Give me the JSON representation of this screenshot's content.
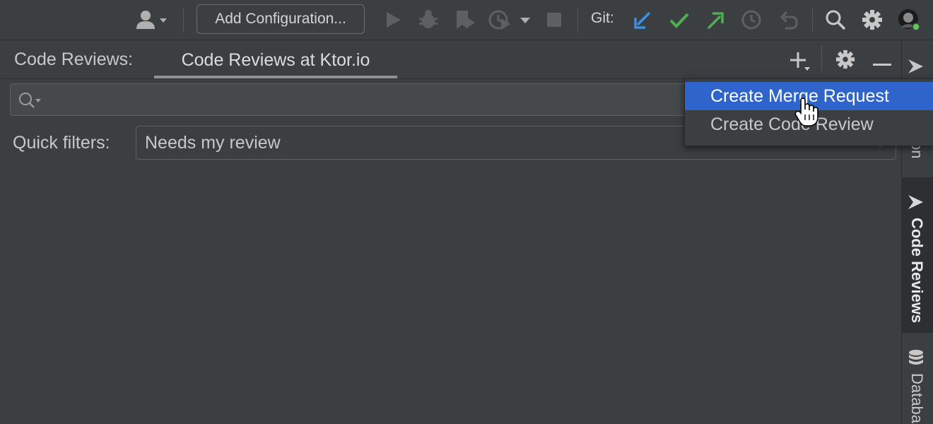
{
  "toolbar": {
    "add_configuration_label": "Add Configuration...",
    "git_label": "Git:",
    "icons": [
      "user-icon",
      "chevron-down-icon",
      "run-icon",
      "debug-icon",
      "coverage-icon",
      "profile-icon",
      "stop-icon",
      "git-update-icon",
      "git-commit-icon",
      "git-push-icon",
      "history-icon",
      "rollback-icon",
      "search-icon",
      "gear-icon",
      "avatar"
    ]
  },
  "tool_window": {
    "title": "Code Reviews:",
    "tab_label": "Code Reviews at Ktor.io"
  },
  "filters": {
    "quick_filters_label": "Quick filters:",
    "quick_filter_value": "Needs my review"
  },
  "popup_menu": {
    "items": [
      {
        "label": "Create Merge Request",
        "selected": true
      },
      {
        "label": "Create Code Review",
        "selected": false
      }
    ]
  },
  "right_sidebar": {
    "partial_tab_label": "on",
    "code_reviews_label": "Code Reviews",
    "database_label": "Databa"
  },
  "colors": {
    "selection": "#2f65ca",
    "git_update": "#3d8fe0",
    "git_commit": "#4caf50",
    "git_push": "#4caf50",
    "online_status": "#5ac85a"
  }
}
